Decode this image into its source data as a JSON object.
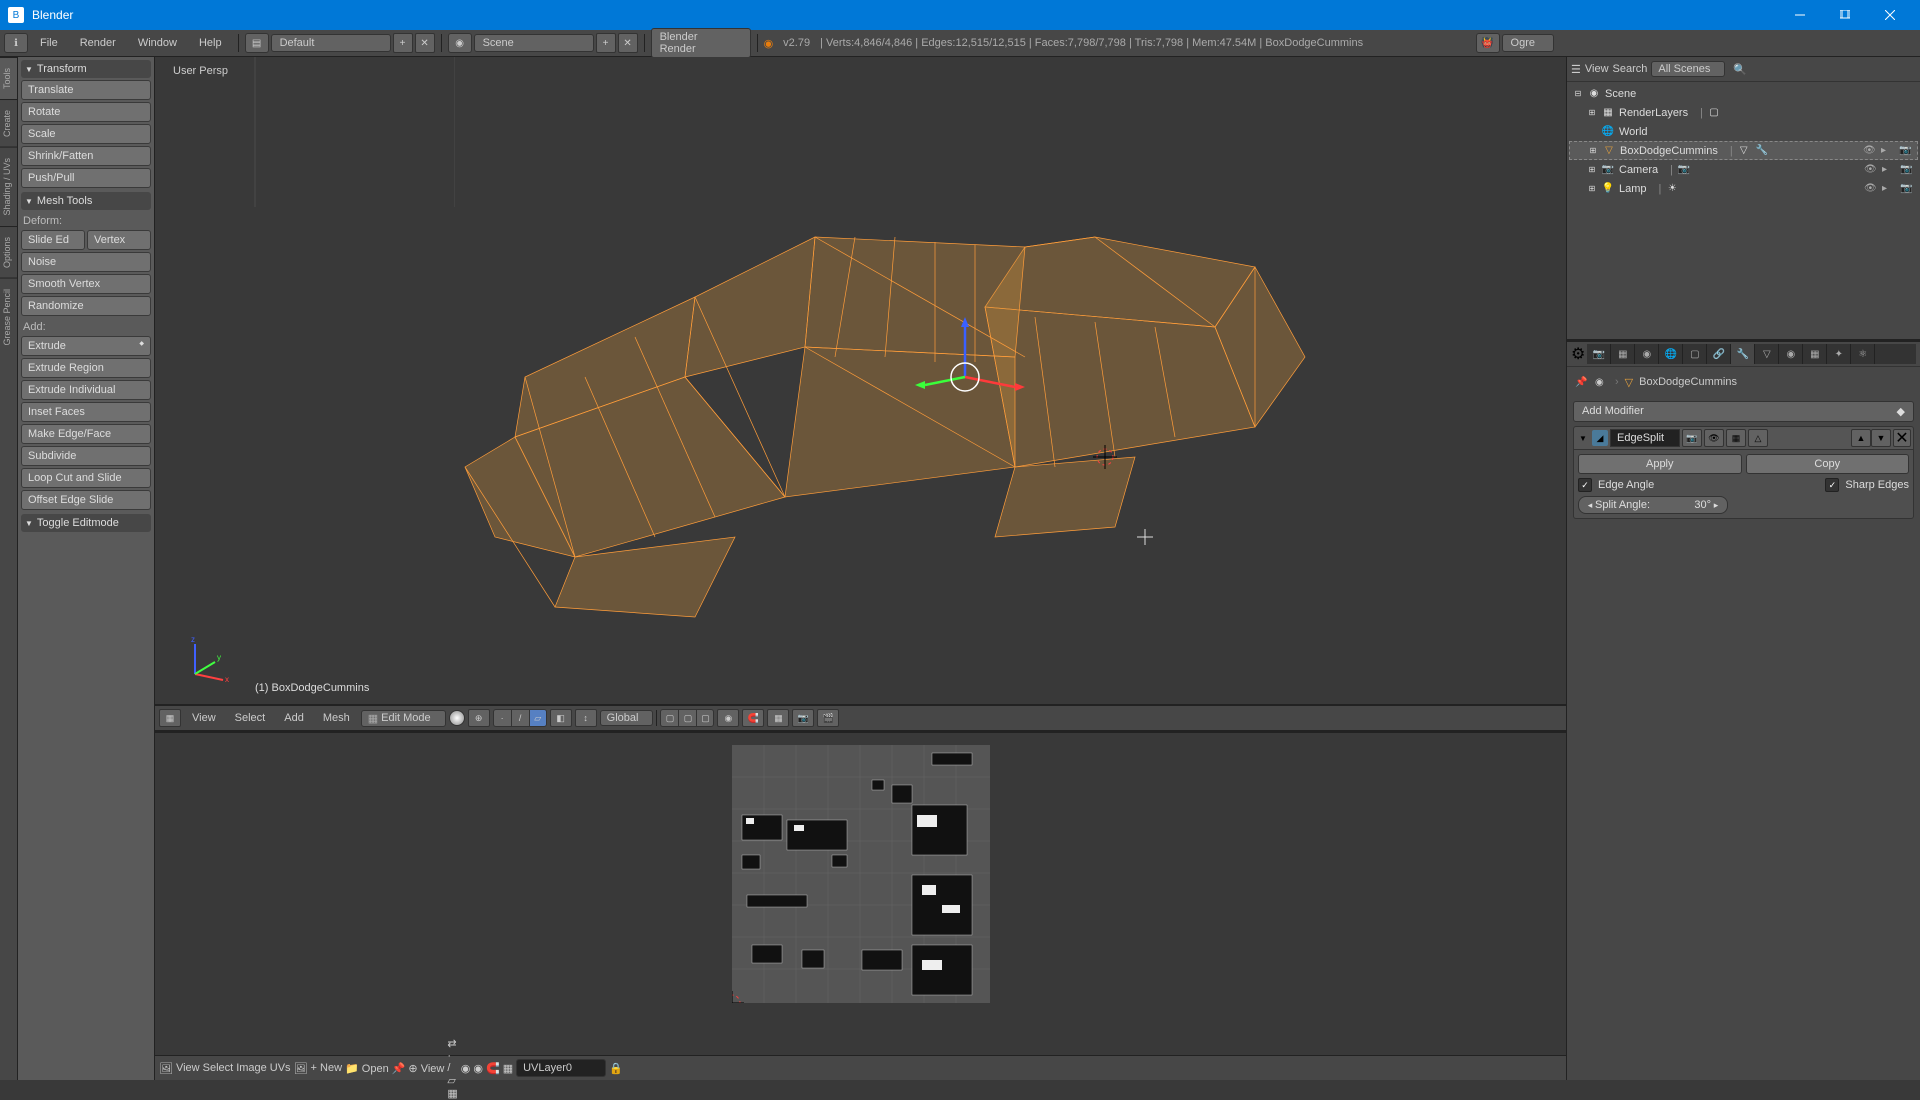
{
  "app": {
    "title": "Blender"
  },
  "menubar": {
    "file": "File",
    "render": "Render",
    "window": "Window",
    "help": "Help",
    "layout_dropdown": "Default",
    "scene_label": "Scene",
    "renderer": "Blender Render",
    "version": "v2.79",
    "stats": "Verts:4,846/4,846 | Edges:12,515/12,515 | Faces:7,798/7,798 | Tris:7,798 | Mem:47.54M | BoxDodgeCummins",
    "ogre_label": "Ogre"
  },
  "left_tabs": [
    "Tools",
    "Create",
    "Shading / UVs",
    "Options",
    "Grease Pencil"
  ],
  "tool_panel": {
    "transform_header": "Transform",
    "transform": {
      "translate": "Translate",
      "rotate": "Rotate",
      "scale": "Scale",
      "shrink": "Shrink/Fatten",
      "pushpull": "Push/Pull"
    },
    "mesh_header": "Mesh Tools",
    "deform_label": "Deform:",
    "deform": {
      "slide_ed": "Slide Ed",
      "vertex": "Vertex",
      "noise": "Noise",
      "smooth": "Smooth Vertex",
      "randomize": "Randomize"
    },
    "add_label": "Add:",
    "add": {
      "extrude": "Extrude",
      "extrude_region": "Extrude Region",
      "extrude_individual": "Extrude Individual",
      "inset": "Inset Faces",
      "make_edge": "Make Edge/Face",
      "subdivide": "Subdivide",
      "loop_cut": "Loop Cut and Slide",
      "offset_edge": "Offset Edge Slide"
    },
    "toggle_editmode": "Toggle Editmode"
  },
  "viewport": {
    "perspective_label": "User Persp",
    "object_label": "(1) BoxDodgeCummins"
  },
  "viewport_header": {
    "view": "View",
    "select": "Select",
    "add": "Add",
    "mesh": "Mesh",
    "mode": "Edit Mode",
    "orientation": "Global"
  },
  "uv_header": {
    "view": "View",
    "select": "Select",
    "image": "Image",
    "uvs": "UVs",
    "new": "New",
    "open": "Open",
    "view_dropdown": "View",
    "layer_name": "UVLayer0"
  },
  "outliner": {
    "header": {
      "view": "View",
      "search": "Search",
      "scenes_dropdown": "All Scenes"
    },
    "tree": {
      "scene": "Scene",
      "renderlayers": "RenderLayers",
      "world": "World",
      "object": "BoxDodgeCummins",
      "camera": "Camera",
      "lamp": "Lamp"
    }
  },
  "properties": {
    "breadcrumb_object": "BoxDodgeCummins",
    "add_modifier": "Add Modifier",
    "modifier": {
      "name": "EdgeSplit",
      "apply": "Apply",
      "copy": "Copy",
      "edge_angle": "Edge Angle",
      "sharp_edges": "Sharp Edges",
      "split_angle_label": "Split Angle:",
      "split_angle_value": "30°"
    }
  }
}
